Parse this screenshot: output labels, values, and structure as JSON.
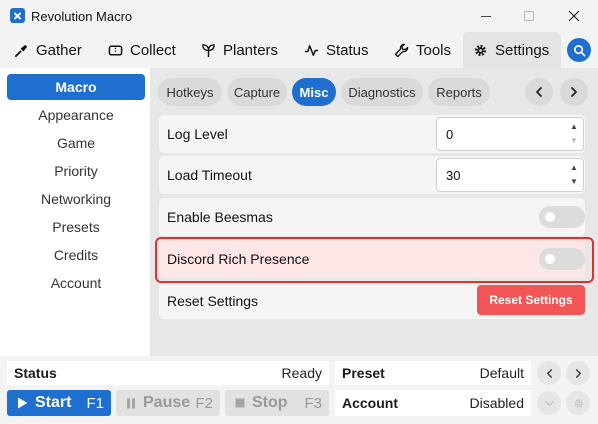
{
  "window": {
    "title": "Revolution Macro"
  },
  "nav": {
    "tabs": [
      {
        "label": "Gather",
        "icon": "trowel-icon"
      },
      {
        "label": "Collect",
        "icon": "ticket-icon"
      },
      {
        "label": "Planters",
        "icon": "sprout-icon"
      },
      {
        "label": "Status",
        "icon": "pulse-icon"
      },
      {
        "label": "Tools",
        "icon": "wrench-icon"
      },
      {
        "label": "Settings",
        "icon": "gear-icon"
      }
    ],
    "active": "Settings"
  },
  "sidebar": {
    "items": [
      "Macro",
      "Appearance",
      "Game",
      "Priority",
      "Networking",
      "Presets",
      "Credits",
      "Account"
    ],
    "active": "Macro"
  },
  "subtabs": {
    "items": [
      "Hotkeys",
      "Capture",
      "Misc",
      "Diagnostics",
      "Reports"
    ],
    "active": "Misc"
  },
  "settings": {
    "log_level": {
      "label": "Log Level",
      "value": "0"
    },
    "load_timeout": {
      "label": "Load Timeout",
      "value": "30"
    },
    "enable_beesmas": {
      "label": "Enable Beesmas",
      "enabled": false
    },
    "discord_rich_presence": {
      "label": "Discord Rich Presence",
      "enabled": false
    },
    "reset": {
      "label": "Reset Settings",
      "button": "Reset Settings"
    }
  },
  "status": {
    "label": "Status",
    "value": "Ready"
  },
  "controls": {
    "start": {
      "label": "Start",
      "key": "F1"
    },
    "pause": {
      "label": "Pause",
      "key": "F2"
    },
    "stop": {
      "label": "Stop",
      "key": "F3"
    }
  },
  "preset": {
    "label": "Preset",
    "value": "Default"
  },
  "account": {
    "label": "Account",
    "value": "Disabled"
  },
  "colors": {
    "accent": "#1f6fd1",
    "danger": "#f25555",
    "highlight_border": "#e03131"
  }
}
